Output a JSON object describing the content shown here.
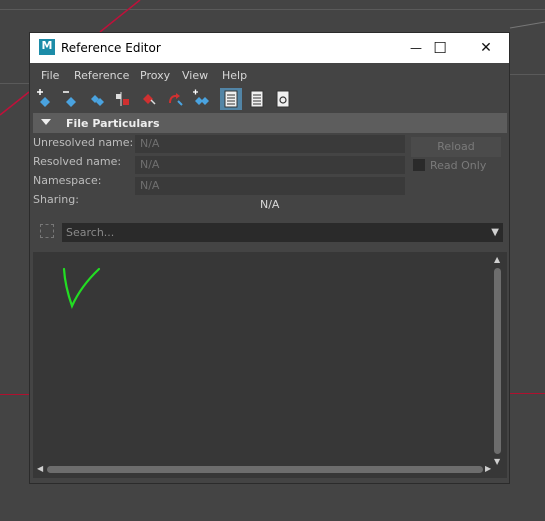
{
  "window": {
    "title": "Reference Editor",
    "app_icon_letter": "M",
    "minimize": "—",
    "maximize": "☐",
    "close": "✕"
  },
  "menu": [
    "File",
    "Reference",
    "Proxy",
    "View",
    "Help"
  ],
  "toolbar": {
    "icons": [
      "add-reference-icon",
      "remove-reference-icon",
      "reload-reference-icon",
      "proxy-icon",
      "unload-reference-icon",
      "revert-icon",
      "duplicate-reference-icon",
      "list-view-icon",
      "file-view-icon",
      "refresh-view-icon"
    ],
    "active_index": 7
  },
  "file_particulars": {
    "section_title": "File Particulars",
    "unresolved_label": "Unresolved name:",
    "unresolved_value": "N/A",
    "resolved_label": "Resolved name:",
    "resolved_value": "N/A",
    "namespace_label": "Namespace:",
    "namespace_value": "N/A",
    "sharing_label": "Sharing:",
    "sharing_value": "N/A",
    "reload_label": "Reload",
    "read_only_label": "Read Only",
    "read_only_checked": false
  },
  "search": {
    "placeholder": "Search..."
  },
  "colors": {
    "accent": "#5285a6",
    "annotation_green": "#22dd22",
    "background_line": "#c0103a"
  }
}
